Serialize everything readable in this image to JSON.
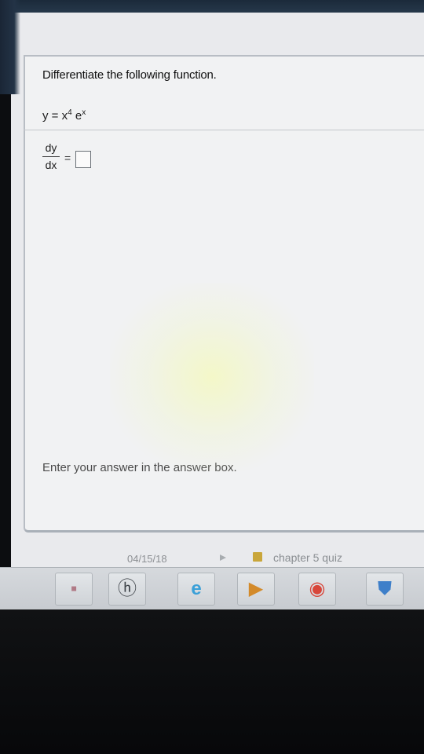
{
  "question": {
    "prompt": "Differentiate the following function.",
    "function_lhs": "y = x",
    "function_exp1": "4",
    "function_mid": " e",
    "function_exp2": "x"
  },
  "derivative": {
    "numerator": "dy",
    "denominator": "dx",
    "equals": "="
  },
  "hint": "Enter your answer in the answer box.",
  "statusbar": {
    "date": "04/15/18",
    "quiz_label": "chapter 5 quiz"
  },
  "taskbar": {
    "items": [
      {
        "name": "app-icon",
        "glyph": "▪",
        "color": "#b07a86"
      },
      {
        "name": "hp-icon",
        "glyph": "ⓗ",
        "color": "#3a3f45"
      },
      {
        "name": "internet-explorer-icon",
        "glyph": "e",
        "color": "#3aa0d8"
      },
      {
        "name": "media-player-icon",
        "glyph": "▶",
        "color": "#d38a2a"
      },
      {
        "name": "chrome-icon",
        "glyph": "◉",
        "color": "#d8463a"
      },
      {
        "name": "shield-icon",
        "glyph": "⛊",
        "color": "#3e7fc9"
      }
    ]
  }
}
